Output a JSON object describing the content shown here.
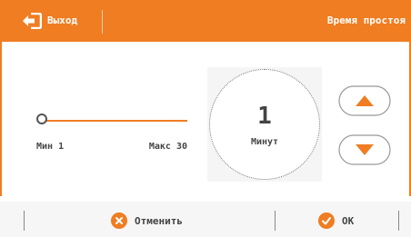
{
  "header": {
    "back_label": "Выход",
    "title": "Время простоя"
  },
  "slider": {
    "min_label": "Мин 1",
    "max_label": "Макс 30",
    "min": 1,
    "max": 30,
    "value": 1
  },
  "dial": {
    "value": "1",
    "unit": "Минут"
  },
  "footer": {
    "cancel_label": "Отменить",
    "ok_label": "OK"
  },
  "colors": {
    "accent": "#f07d22",
    "text": "#444444",
    "footer_bg": "#f6f6f6"
  },
  "icons": {
    "back": "exit-arrow-icon",
    "up": "arrow-up-icon",
    "down": "arrow-down-icon",
    "cancel": "close-icon",
    "ok": "check-icon"
  }
}
